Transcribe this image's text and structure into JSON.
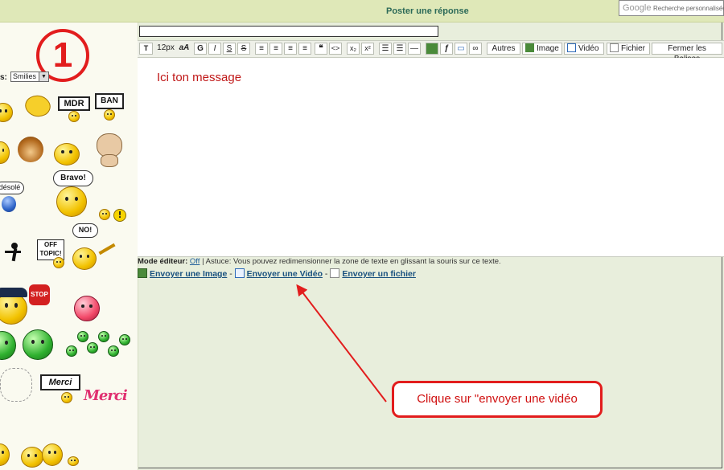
{
  "header": {
    "title": "Poster une réponse"
  },
  "google": {
    "logo": "Google",
    "search_label": "Recherche personnalisée"
  },
  "sidebar": {
    "step_number": "1",
    "smilies_label": "s:",
    "smilies_selected": "Smilies",
    "sign_mdr": "MDR",
    "sign_ban": "BAN",
    "bubble_bravo": "Bravo!",
    "bubble_desole": "désolé",
    "bubble_no": "NO!",
    "sign_offtopic": "OFF TOPIC!",
    "sign_stop": "STOP",
    "sign_merci": "Merci",
    "merci_word": "Merci"
  },
  "toolbar": {
    "font_size": "12px",
    "font_toggle": "aA",
    "bold": "G",
    "italic": "I",
    "underline": "S",
    "strike": "S",
    "quote": "❝",
    "code": "<>",
    "subscript": "x₂",
    "superscript": "x²",
    "autres": "Autres",
    "image": "Image",
    "video": "Vidéo",
    "fichier": "Fichier",
    "fermer": "Fermer les Balises"
  },
  "editor": {
    "message": "Ici ton message"
  },
  "mode_line": {
    "label": "Mode éditeur:",
    "state": "Off",
    "tip": "| Astuce: Vous pouvez redimensionner la zone de texte en glissant la souris sur ce texte."
  },
  "links": {
    "image": "Envoyer une Image",
    "sep1": "-",
    "video": "Envoyer une Vidéo",
    "sep2": "-",
    "file": "Envoyer un fichier"
  },
  "annotation": {
    "text": "Clique sur \"envoyer une vidéo"
  },
  "colors": {
    "annotation_red": "#e21d1d",
    "header_bg": "#dfe8b8",
    "link_blue": "#19517f"
  }
}
